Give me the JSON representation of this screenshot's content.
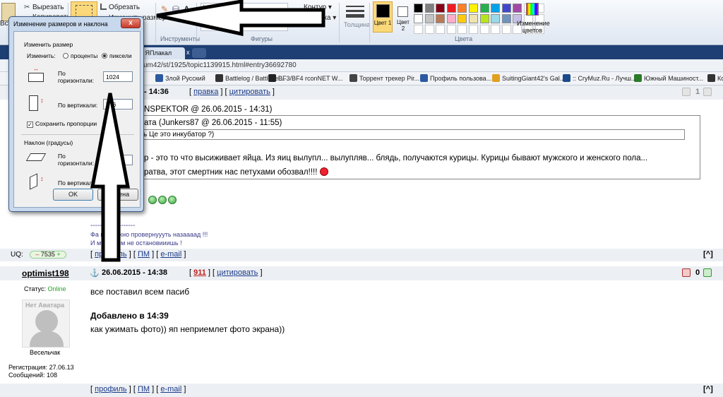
{
  "ribbon": {
    "clipboard": {
      "cut": "Вырезать",
      "copy": "Копировать",
      "paste_partial": "Вста"
    },
    "image": {
      "crop": "Обрезать",
      "resize": "Изменить размер"
    },
    "groups": {
      "tools": "Инструменты",
      "shapes": "Фигуры",
      "colors": "Цвета"
    },
    "contour": "Контур",
    "fill": "Заливка",
    "thickness": "Толщина",
    "color1": "Цвет 1",
    "color2": "Цвет 2",
    "edit_colors": "Изменение цветов",
    "palette_row1": [
      "#000000",
      "#7f7f7f",
      "#880015",
      "#ed1c24",
      "#ff7f27",
      "#fff200",
      "#22b14c",
      "#00a2e8",
      "#3f48cc",
      "#a349a4"
    ],
    "palette_row2": [
      "#ffffff",
      "#c3c3c3",
      "#b97a57",
      "#ffaec9",
      "#ffc90e",
      "#efe4b0",
      "#b5e61d",
      "#99d9ea",
      "#7092be",
      "#c8bfe7"
    ]
  },
  "browser": {
    "tab_label": "- ЯПлакал",
    "url": "um42/st/1925/topic1139915.html#entry36692780",
    "bookmarks": [
      {
        "label": "Злой Русский",
        "icon": "#2c5aa0"
      },
      {
        "label": "Battlelog / Battlefiel...",
        "icon": "#333333"
      },
      {
        "label": "BF3/BF4 rconNET W...",
        "icon": "#222222"
      },
      {
        "label": "Торрент трекер Pir...",
        "icon": "#444444"
      },
      {
        "label": "Профиль пользова...",
        "icon": "#2c5aa0"
      },
      {
        "label": "SuitingGiant42's Gal...",
        "icon": "#e0a020"
      },
      {
        "label": ":: CryMuz.Ru - Лучш...",
        "icon": "#1a4a8a"
      },
      {
        "label": "Южный Машиност...",
        "icon": "#2a7a2a"
      },
      {
        "label": "Ко",
        "icon": "#333333"
      }
    ]
  },
  "post1": {
    "time": "- 14:36",
    "edit": "правка",
    "cite": "цитировать",
    "rating": "1",
    "quote_header": "NSPEKTOR @ 26.06.2015 - 14:31)",
    "inner_quote_author": "ата (Junkers87 @ 26.06.2015 - 11:55)",
    "inner_quote_text": "ь Це это инкубатор ?)",
    "body_line1": "р - это то что высиживает яйца. Из яиц вылупл... вылупляв... блядь, получаются курицы. Курицы бывают мужского и женского пола...",
    "body_line2": "ратва, этот смертник нас петухами обозвал!!!!",
    "sig_line0": "-------------------",
    "sig_line1": "Фа                возможно провернуууть назаааад !!!",
    "sig_line2": "И м                 ыкооом не остановииишь !",
    "uq_label": "UQ:",
    "uq_value": "7535",
    "footer_links": [
      "профиль",
      "ПМ",
      "e-mail"
    ],
    "up": "[^]"
  },
  "post2": {
    "author": "optimist198",
    "date": "26.06.2015 - 14:38",
    "rating_link": "911",
    "cite": "цитировать",
    "rating": "0",
    "status_label": "Статус:",
    "status_value": "Online",
    "avatar_caption": "Нет Аватара",
    "rank": "Весельчак",
    "registration": "Регистрация: 27.06.13",
    "messages": "Сообщений: 108",
    "body_line1": "все поставил всем пасиб",
    "added": "Добавлено в 14:39",
    "body_line2": "как ужимать фото)) яп неприемлет фото экрана))",
    "footer_links": [
      "профиль",
      "ПМ",
      "e-mail"
    ],
    "up": "[^]"
  },
  "dialog": {
    "title": "Изменение размеров и наклона",
    "close": "x",
    "resize_section": "Изменить размер",
    "by_label": "Изменить:",
    "opt_percent": "проценты",
    "opt_pixels": "пиксели",
    "horiz_label": "По горизонтали:",
    "horiz_value": "1024",
    "vert_label": "По вертикали:",
    "vert_value": "576",
    "keep_ratio": "Сохранить пропорции",
    "skew_section": "Наклон (градусы)",
    "skew_horiz_label": "По горизонтали:",
    "skew_vert_label": "По вертикали:",
    "ok": "OK",
    "cancel": "Отмена"
  }
}
